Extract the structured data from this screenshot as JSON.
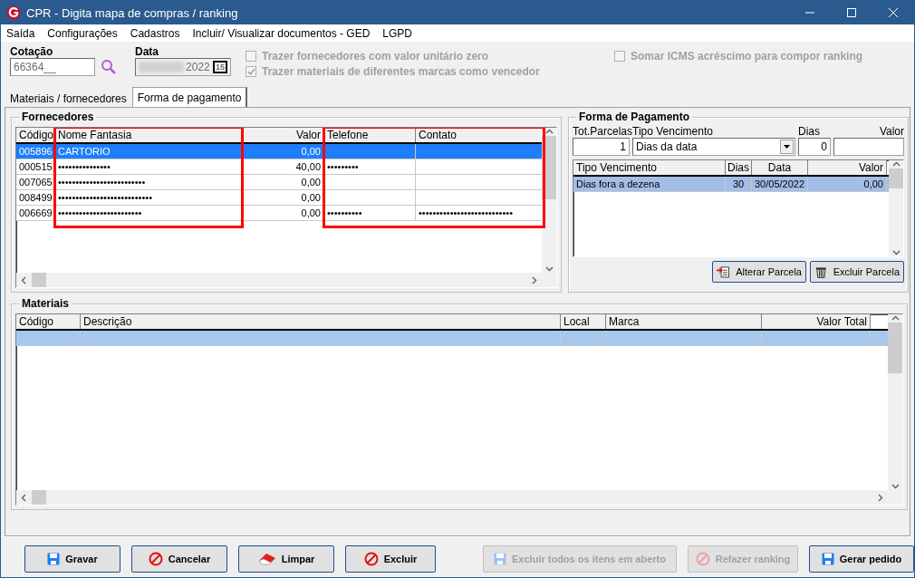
{
  "window": {
    "title": "CPR - Digita mapa de compras / ranking"
  },
  "menu": [
    "Saída",
    "Configurações",
    "Cadastros",
    "Incluir/ Visualizar documentos - GED",
    "LGPD"
  ],
  "filters": {
    "cotacao_label": "Cotação",
    "cotacao_value": "66364__",
    "data_label": "Data",
    "data_value": "2022",
    "calendar_button": "15",
    "checkboxes": [
      {
        "label": "Trazer fornecedores com valor unitário zero",
        "checked": false,
        "disabled": true
      },
      {
        "label": "Trazer materiais de diferentes marcas como vencedor",
        "checked": true,
        "disabled": true
      },
      {
        "label": "Somar ICMS acréscimo para compor ranking",
        "checked": false,
        "disabled": true
      }
    ]
  },
  "tabs": [
    {
      "label": "Materiais / fornecedores",
      "selected": false
    },
    {
      "label": "Forma de pagamento",
      "selected": true
    }
  ],
  "fornecedores": {
    "title": "Fornecedores",
    "columns": [
      {
        "label": "Código",
        "highlighted": false
      },
      {
        "label": "Nome Fantasia",
        "highlighted": true
      },
      {
        "label": "Valor",
        "highlighted": false
      },
      {
        "label": "Telefone",
        "highlighted": true
      },
      {
        "label": "Contato",
        "highlighted": true
      }
    ],
    "rows": [
      {
        "selected": true,
        "cells": [
          "005896",
          "CARTORIO",
          "0,00"
        ]
      },
      {
        "selected": false,
        "cells": [
          "000515",
          "•••••••••••••••",
          "40,00",
          "•••••••••"
        ]
      },
      {
        "selected": false,
        "cells": [
          "007065",
          "•••••••••••••••••••••••••",
          "0,00"
        ]
      },
      {
        "selected": false,
        "cells": [
          "008499",
          "•••••••••••••••••••••••••••",
          "0,00"
        ]
      },
      {
        "selected": false,
        "cells": [
          "006669",
          "••••••••••••••••••••••••",
          "0,00",
          "••••••••••",
          "•••••••••••••••••••••••••••"
        ]
      }
    ]
  },
  "forma_pagamento": {
    "title": "Forma de Pagamento",
    "tot_parcelas_label": "Tot.Parcelas",
    "tot_parcelas_value": "1",
    "tipo_label": "Tipo Vencimento",
    "tipo_value": "Dias da data",
    "dias_label": "Dias",
    "dias_value": "0",
    "valor_label": "Valor",
    "columns": [
      {
        "label": "Tipo Vencimento"
      },
      {
        "label": "Dias"
      },
      {
        "label": "Data"
      },
      {
        "label": "Valor"
      }
    ],
    "rows": [
      {
        "selected": true,
        "cells": [
          "Dias fora a dezena",
          "30",
          "30/05/2022",
          "0,00"
        ]
      }
    ],
    "buttons": [
      {
        "label": "Alterar Parcela",
        "kind": "edit"
      },
      {
        "label": "Excluir Parcela",
        "kind": "trash"
      }
    ]
  },
  "materiais": {
    "title": "Materiais",
    "columns": [
      "Código",
      "Descrição",
      "Local",
      "Marca",
      "Valor Total"
    ],
    "rows": [
      {
        "selected": true
      }
    ]
  },
  "buttons": [
    {
      "label": "Gravar",
      "kind": "save",
      "disabled": false
    },
    {
      "label": "Cancelar",
      "kind": "cancel",
      "disabled": false
    },
    {
      "label": "Limpar",
      "kind": "eraser",
      "disabled": false
    },
    {
      "label": "Excluir",
      "kind": "cancel",
      "disabled": false
    },
    {
      "label": "Excluir todos os itens em aberto",
      "kind": "save",
      "disabled": true
    },
    {
      "label": "Refazer ranking",
      "kind": "cancel",
      "disabled": true
    },
    {
      "label": "Gerar pedido",
      "kind": "save",
      "disabled": false
    }
  ]
}
